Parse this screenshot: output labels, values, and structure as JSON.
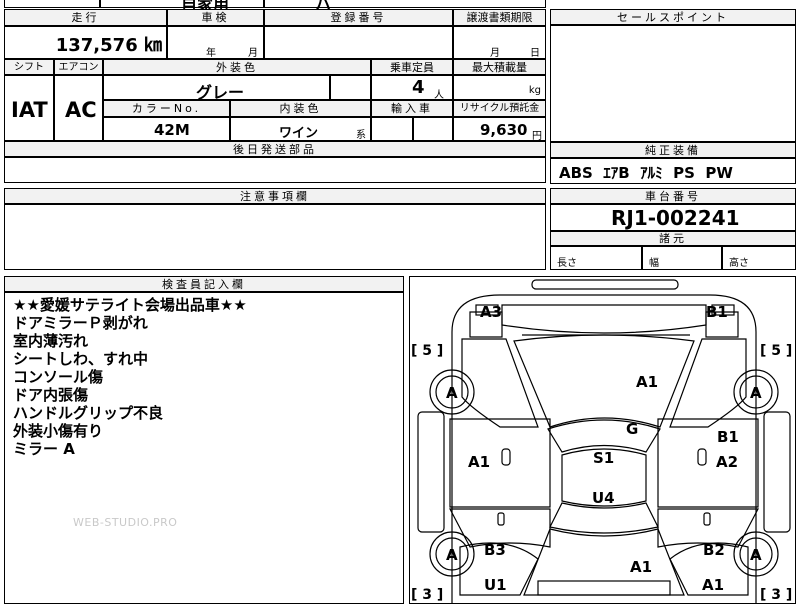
{
  "top_partial": {
    "left": "",
    "middle": "自家用",
    "right": "ハ"
  },
  "mileage": {
    "label": "走行",
    "value": "137,576 ㎞"
  },
  "inspection": {
    "label": "車検",
    "year_unit": "年",
    "month_unit": "月"
  },
  "registration": {
    "label": "登録番号"
  },
  "transfer_deadline": {
    "label": "譲渡書類期限",
    "month_unit": "月",
    "day_unit": "日"
  },
  "shift": {
    "label": "シフト",
    "value": "IAT"
  },
  "aircon": {
    "label": "エアコン",
    "value": "AC"
  },
  "exterior_color": {
    "label": "外装色",
    "value": "グレー"
  },
  "capacity": {
    "label": "乗車定員",
    "value": "4",
    "unit": "人"
  },
  "max_load": {
    "label": "最大積載量",
    "unit": "kg"
  },
  "color_no": {
    "label": "カラーNo.",
    "value": "42M"
  },
  "interior_color": {
    "label": "内装色",
    "value": "ワイン",
    "suffix": "系"
  },
  "import": {
    "label": "輸入車"
  },
  "recycle": {
    "label": "リサイクル預託金",
    "value": "9,630",
    "unit": "円"
  },
  "later_parts": {
    "label": "後日発送部品"
  },
  "sales_point": {
    "label": "セールスポイント"
  },
  "equipment": {
    "label": "純正装備",
    "value": "ABS  ｴｱB  ｱﾙﾐ  PS  PW"
  },
  "caution": {
    "label": "注意事項欄"
  },
  "chassis": {
    "label": "車台番号",
    "value": "RJ1-002241"
  },
  "dimensions": {
    "label": "諸元",
    "length": "長さ",
    "width": "幅",
    "height": "高さ"
  },
  "inspector": {
    "label": "検査員記入欄",
    "notes": [
      "★★愛媛サテライト会場出品車★★",
      "ドアミラーＰ剥がれ",
      "室内薄汚れ",
      "シートしわ、すれ中",
      "コンソール傷",
      "ドア内張傷",
      "ハンドルグリップ不良",
      "外装小傷有り",
      "ミラー A"
    ]
  },
  "watermark": "WEB-STUDIO.PRO",
  "diagram": {
    "marks": {
      "a3": "A3",
      "b1_top": "B1",
      "a1_hood": "A1",
      "g": "G",
      "b1_right": "B1",
      "a2": "A2",
      "a1_left": "A1",
      "s1": "S1",
      "u4": "U4",
      "b3": "B3",
      "b2": "B2",
      "a1_rear": "A1",
      "u1": "U1",
      "a1_rear_right": "A1",
      "tire_fl": "A",
      "tire_fr": "A",
      "tire_rl": "A",
      "tire_rr": "A"
    },
    "tread": {
      "fl": "[ 5 ]",
      "fr": "[ 5 ]",
      "rl": "[ 3 ]",
      "rr": "[ 3 ]"
    }
  }
}
